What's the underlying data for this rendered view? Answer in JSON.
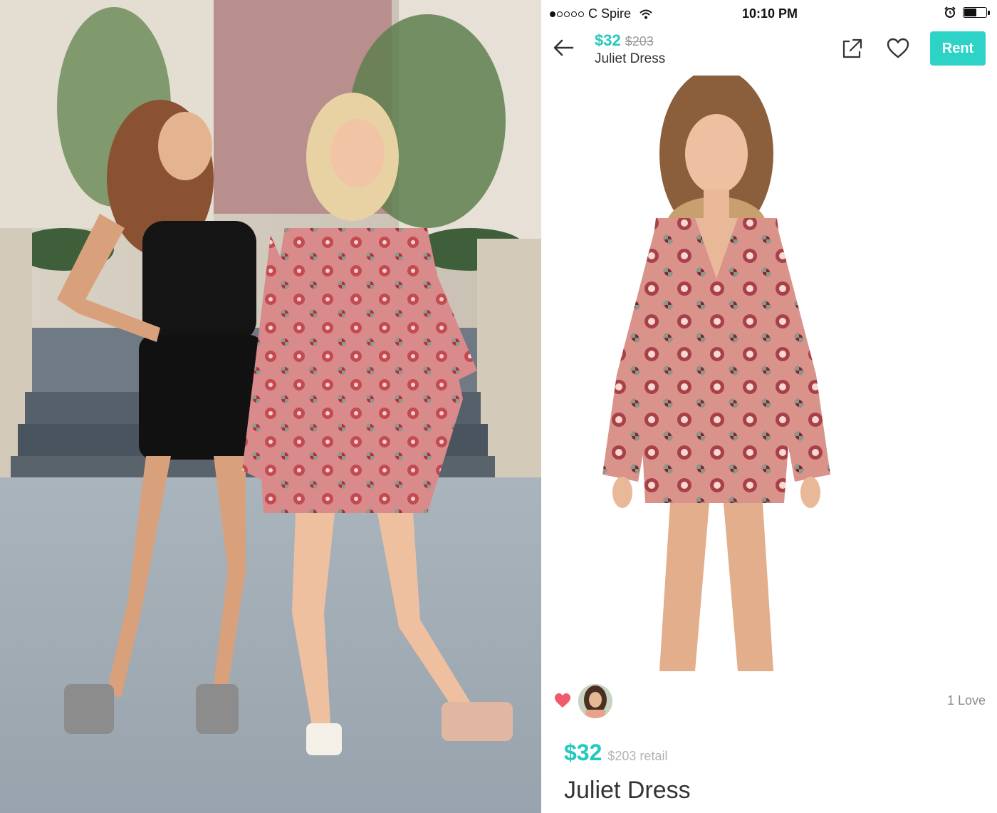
{
  "status_bar": {
    "carrier": "C Spire",
    "time": "10:10 PM",
    "battery_level": 0.6,
    "signal_bars_filled": 1,
    "signal_bars_total": 5
  },
  "nav": {
    "price": "$32",
    "retail_price": "$203",
    "product_name": "Juliet Dress",
    "rent_label": "Rent",
    "icons": [
      "back-arrow-icon",
      "share-icon",
      "heart-outline-icon"
    ]
  },
  "loves": {
    "count_label": "1 Love",
    "icon": "heart-filled-icon"
  },
  "pricing": {
    "price": "$32",
    "retail_label": "$203 retail"
  },
  "product": {
    "title": "Juliet Dress"
  },
  "colors": {
    "accent": "#2dd3c6",
    "price_text": "#22c9bd",
    "love_heart": "#f05a6a"
  }
}
